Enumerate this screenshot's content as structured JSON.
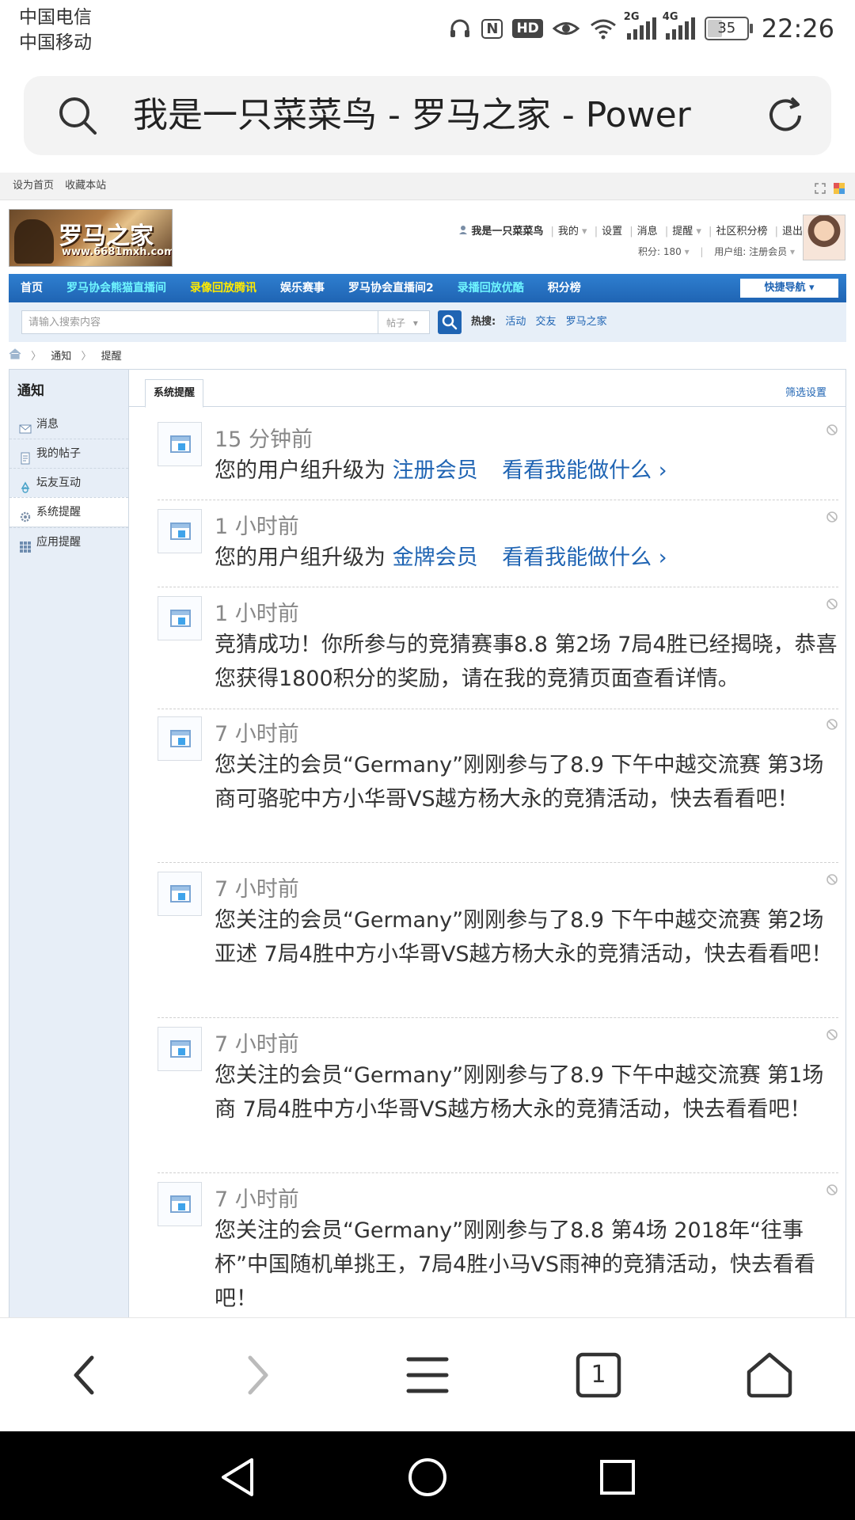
{
  "status_bar": {
    "carrier_1": "中国电信",
    "carrier_2": "中国移动",
    "nfc": "N",
    "hd": "HD",
    "net_1": "2G",
    "net_2": "4G",
    "battery": "35",
    "time": "22:26"
  },
  "address_bar": {
    "title": "我是一只菜菜鸟 - 罗马之家 - Power"
  },
  "site": {
    "top_links": [
      "设为首页",
      "收藏本站"
    ],
    "logo_text": "罗马之家",
    "logo_url": "www.6681mxh.com",
    "user": {
      "name": "我是一只菜菜鸟",
      "links": [
        "我的",
        "设置",
        "消息",
        "提醒",
        "社区积分榜",
        "退出"
      ],
      "points_label": "积分: 180",
      "group_label": "用户组: 注册会员"
    },
    "nav": [
      {
        "label": "首页",
        "color": "#ffffff"
      },
      {
        "label": "罗马协会熊猫直播间",
        "color": "#6ff6ff"
      },
      {
        "label": "录像回放腾讯",
        "color": "#ffea00"
      },
      {
        "label": "娱乐赛事",
        "color": "#ffffff"
      },
      {
        "label": "罗马协会直播间2",
        "color": "#ffffff"
      },
      {
        "label": "录播回放优酷",
        "color": "#6ff6ff"
      },
      {
        "label": "积分榜",
        "color": "#ffffff"
      }
    ],
    "quick_nav": "快捷导航",
    "search": {
      "placeholder": "请输入搜索内容",
      "scope": "帖子",
      "hot_label": "热搜:",
      "hot_terms": [
        "活动",
        "交友",
        "罗马之家"
      ]
    },
    "breadcrumb": [
      "通知",
      "提醒"
    ],
    "sidebar": {
      "title": "通知",
      "items": [
        {
          "label": "消息",
          "icon": "envelope-icon"
        },
        {
          "label": "我的帖子",
          "icon": "document-icon"
        },
        {
          "label": "坛友互动",
          "icon": "recycle-icon"
        },
        {
          "label": "系统提醒",
          "icon": "gear-icon",
          "active": true
        },
        {
          "label": "应用提醒",
          "icon": "grid-icon"
        }
      ]
    },
    "tabs": {
      "active": "系统提醒",
      "filter": "筛选设置"
    },
    "notices": [
      {
        "time": "15 分钟前",
        "text": "您的用户组升级为",
        "link": "注册会员",
        "link2": "看看我能做什么 ›"
      },
      {
        "time": "1 小时前",
        "text": "您的用户组升级为",
        "link": "金牌会员",
        "link2": "看看我能做什么 ›"
      },
      {
        "time": "1 小时前",
        "text": "竞猜成功！你所参与的竞猜赛事8.8 第2场 7局4胜已经揭晓，恭喜您获得1800积分的奖励，请在我的竞猜页面查看详情。"
      },
      {
        "time": "7 小时前",
        "text": "您关注的会员“Germany”刚刚参与了8.9 下午中越交流赛 第3场 商可骆驼中方小华哥VS越方杨大永的竞猜活动，快去看看吧！"
      },
      {
        "time": "7 小时前",
        "text": "您关注的会员“Germany”刚刚参与了8.9 下午中越交流赛 第2场 亚述 7局4胜中方小华哥VS越方杨大永的竞猜活动，快去看看吧！"
      },
      {
        "time": "7 小时前",
        "text": "您关注的会员“Germany”刚刚参与了8.9 下午中越交流赛 第1场 商 7局4胜中方小华哥VS越方杨大永的竞猜活动，快去看看吧！"
      },
      {
        "time": "7 小时前",
        "text": "您关注的会员“Germany”刚刚参与了8.8 第4场 2018年“往事杯”中国随机单挑王，7局4胜小马VS雨神的竞猜活动，快去看看吧！"
      }
    ]
  },
  "browser_bar": {
    "tabs_count": "1"
  }
}
